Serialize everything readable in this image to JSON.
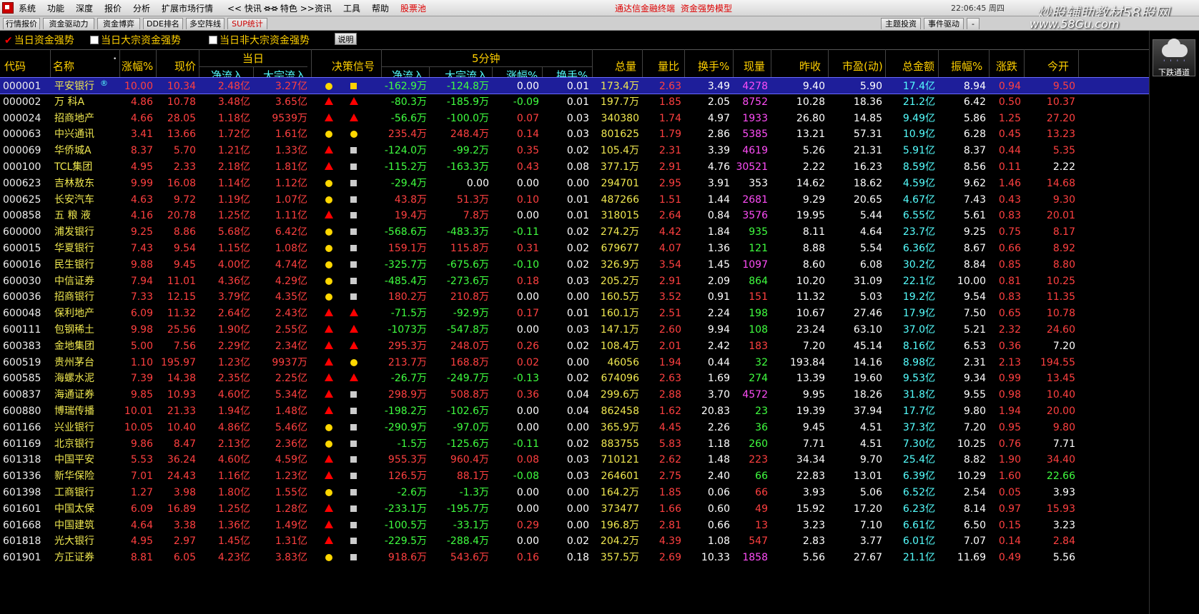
{
  "menubar": {
    "items": [
      "系统",
      "功能",
      "深度",
      "报价",
      "分析",
      "扩展市场行情",
      "<< 快讯 >>",
      "<< 特色 >>",
      "资讯",
      "工具",
      "帮助",
      "股票池"
    ],
    "right_links": [
      "通达信金融终端",
      "资金强势模型"
    ],
    "clock": "22:06:45 周四"
  },
  "brand": {
    "watermark": "炒股辅助教材58股网",
    "url": "www.58Gu.com"
  },
  "tabs": [
    "行情报价",
    "资金驱动力",
    "资金博弈",
    "DDE排名",
    "多空阵线",
    "SUP统计"
  ],
  "tabs_right": [
    "主题投资",
    "事件驱动",
    "-"
  ],
  "filters": {
    "opt1": "当日资金强势",
    "opt2": "当日大宗资金强势",
    "opt3": "当日非大宗资金强势",
    "explain": "说明"
  },
  "header": {
    "code": "代码",
    "name": "名称",
    "change_pct": "涨幅%",
    "price": "现价",
    "today": "当日",
    "net_inflow": "净流入",
    "block_inflow": "大宗流入",
    "signal": "决策信号",
    "five_min": "5分钟",
    "net_inflow_5": "净流入",
    "block_inflow_5": "大宗流入",
    "change_pct_5": "涨幅%",
    "turnover_5": "换手%",
    "total_vol": "总量",
    "vol_ratio": "量比",
    "turnover": "换手%",
    "cur_vol": "现量",
    "prev_close": "昨收",
    "pe": "市盈(动)",
    "amount": "总金额",
    "amplitude": "振幅%",
    "change": "涨跌",
    "open": "今开"
  },
  "side": {
    "weather_label": "下跌通道"
  },
  "rows": [
    {
      "code": "000001",
      "name": "平安银行",
      "mark": "®",
      "chg": "10.00",
      "price": "10.34",
      "net": "2.48亿",
      "blk": "3.27亿",
      "s1": "circle",
      "s2": "square-yellow",
      "net5": "-162.9万",
      "blk5": "-124.8万",
      "chg5": "0.00",
      "to5": "0.01",
      "vol": "173.4万",
      "vr": "2.63",
      "to": "3.49",
      "cv": "4278",
      "pc": "9.40",
      "pe": "5.90",
      "amt": "17.4亿",
      "amp": "8.94",
      "d": "0.94",
      "op": "9.50",
      "net5dir": "dn",
      "blk5dir": "dn",
      "chg5dir": "wh",
      "cvdir": "mg",
      "opdir": "up"
    },
    {
      "code": "000002",
      "name": "万  科A",
      "mark": "",
      "chg": "4.86",
      "price": "10.78",
      "net": "3.48亿",
      "blk": "3.65亿",
      "s1": "triangle",
      "s2": "triangle",
      "net5": "-80.3万",
      "blk5": "-185.9万",
      "chg5": "-0.09",
      "to5": "0.01",
      "vol": "197.7万",
      "vr": "1.85",
      "to": "2.05",
      "cv": "8752",
      "pc": "10.28",
      "pe": "18.36",
      "amt": "21.2亿",
      "amp": "6.42",
      "d": "0.50",
      "op": "10.37",
      "net5dir": "dn",
      "blk5dir": "dn",
      "chg5dir": "dn",
      "cvdir": "mg",
      "opdir": "up"
    },
    {
      "code": "000024",
      "name": "招商地产",
      "mark": "",
      "chg": "4.66",
      "price": "28.05",
      "net": "1.18亿",
      "blk": "9539万",
      "s1": "triangle",
      "s2": "triangle",
      "net5": "-56.6万",
      "blk5": "-100.0万",
      "chg5": "0.07",
      "to5": "0.03",
      "vol": "340380",
      "vr": "1.74",
      "to": "4.97",
      "cv": "1933",
      "pc": "26.80",
      "pe": "14.85",
      "amt": "9.49亿",
      "amp": "5.86",
      "d": "1.25",
      "op": "27.20",
      "net5dir": "dn",
      "blk5dir": "dn",
      "chg5dir": "up",
      "cvdir": "mg",
      "opdir": "up"
    },
    {
      "code": "000063",
      "name": "中兴通讯",
      "mark": "",
      "chg": "3.41",
      "price": "13.66",
      "net": "1.72亿",
      "blk": "1.61亿",
      "s1": "circle",
      "s2": "circle",
      "net5": "235.4万",
      "blk5": "248.4万",
      "chg5": "0.14",
      "to5": "0.03",
      "vol": "801625",
      "vr": "1.79",
      "to": "2.86",
      "cv": "5385",
      "pc": "13.21",
      "pe": "57.31",
      "amt": "10.9亿",
      "amp": "6.28",
      "d": "0.45",
      "op": "13.23",
      "net5dir": "up",
      "blk5dir": "up",
      "chg5dir": "up",
      "cvdir": "mg",
      "opdir": "up"
    },
    {
      "code": "000069",
      "name": "华侨城A",
      "mark": "",
      "chg": "8.37",
      "price": "5.70",
      "net": "1.21亿",
      "blk": "1.33亿",
      "s1": "triangle",
      "s2": "square",
      "net5": "-124.0万",
      "blk5": "-99.2万",
      "chg5": "0.35",
      "to5": "0.02",
      "vol": "105.4万",
      "vr": "2.31",
      "to": "3.39",
      "cv": "4619",
      "pc": "5.26",
      "pe": "21.31",
      "amt": "5.91亿",
      "amp": "8.37",
      "d": "0.44",
      "op": "5.35",
      "net5dir": "dn",
      "blk5dir": "dn",
      "chg5dir": "up",
      "cvdir": "mg",
      "opdir": "up"
    },
    {
      "code": "000100",
      "name": "TCL集团",
      "mark": "",
      "chg": "4.95",
      "price": "2.33",
      "net": "2.18亿",
      "blk": "1.81亿",
      "s1": "triangle",
      "s2": "square",
      "net5": "-115.2万",
      "blk5": "-163.3万",
      "chg5": "0.43",
      "to5": "0.08",
      "vol": "377.1万",
      "vr": "2.91",
      "to": "4.76",
      "cv": "30521",
      "pc": "2.22",
      "pe": "16.23",
      "amt": "8.59亿",
      "amp": "8.56",
      "d": "0.11",
      "op": "2.22",
      "net5dir": "dn",
      "blk5dir": "dn",
      "chg5dir": "up",
      "cvdir": "mg",
      "opdir": "wh"
    },
    {
      "code": "000623",
      "name": "吉林敖东",
      "mark": "",
      "chg": "9.99",
      "price": "16.08",
      "net": "1.14亿",
      "blk": "1.12亿",
      "s1": "circle",
      "s2": "square",
      "net5": "-29.4万",
      "blk5": "0.00",
      "chg5": "0.00",
      "to5": "0.00",
      "vol": "294701",
      "vr": "2.95",
      "to": "3.91",
      "cv": "353",
      "pc": "14.62",
      "pe": "18.62",
      "amt": "4.59亿",
      "amp": "9.62",
      "d": "1.46",
      "op": "14.68",
      "net5dir": "dn",
      "blk5dir": "wh",
      "chg5dir": "wh",
      "cvdir": "wh",
      "opdir": "up"
    },
    {
      "code": "000625",
      "name": "长安汽车",
      "mark": "",
      "chg": "4.63",
      "price": "9.72",
      "net": "1.19亿",
      "blk": "1.07亿",
      "s1": "circle",
      "s2": "square",
      "net5": "43.8万",
      "blk5": "51.3万",
      "chg5": "0.10",
      "to5": "0.01",
      "vol": "487266",
      "vr": "1.51",
      "to": "1.44",
      "cv": "2681",
      "pc": "9.29",
      "pe": "20.65",
      "amt": "4.67亿",
      "amp": "7.43",
      "d": "0.43",
      "op": "9.30",
      "net5dir": "up",
      "blk5dir": "up",
      "chg5dir": "up",
      "cvdir": "mg",
      "opdir": "up"
    },
    {
      "code": "000858",
      "name": "五 粮 液",
      "mark": "",
      "chg": "4.16",
      "price": "20.78",
      "net": "1.25亿",
      "blk": "1.11亿",
      "s1": "triangle",
      "s2": "square",
      "net5": "19.4万",
      "blk5": "7.8万",
      "chg5": "0.00",
      "to5": "0.01",
      "vol": "318015",
      "vr": "2.64",
      "to": "0.84",
      "cv": "3576",
      "pc": "19.95",
      "pe": "5.44",
      "amt": "6.55亿",
      "amp": "5.61",
      "d": "0.83",
      "op": "20.01",
      "net5dir": "up",
      "blk5dir": "up",
      "chg5dir": "wh",
      "cvdir": "mg",
      "opdir": "up"
    },
    {
      "code": "600000",
      "name": "浦发银行",
      "mark": "",
      "chg": "9.25",
      "price": "8.86",
      "net": "5.68亿",
      "blk": "6.42亿",
      "s1": "circle",
      "s2": "square",
      "net5": "-568.6万",
      "blk5": "-483.3万",
      "chg5": "-0.11",
      "to5": "0.02",
      "vol": "274.2万",
      "vr": "4.42",
      "to": "1.84",
      "cv": "935",
      "pc": "8.11",
      "pe": "4.64",
      "amt": "23.7亿",
      "amp": "9.25",
      "d": "0.75",
      "op": "8.17",
      "net5dir": "dn",
      "blk5dir": "dn",
      "chg5dir": "dn",
      "cvdir": "gr",
      "opdir": "up"
    },
    {
      "code": "600015",
      "name": "华夏银行",
      "mark": "",
      "chg": "7.43",
      "price": "9.54",
      "net": "1.15亿",
      "blk": "1.08亿",
      "s1": "circle",
      "s2": "square",
      "net5": "159.1万",
      "blk5": "115.8万",
      "chg5": "0.31",
      "to5": "0.02",
      "vol": "679677",
      "vr": "4.07",
      "to": "1.36",
      "cv": "121",
      "pc": "8.88",
      "pe": "5.54",
      "amt": "6.36亿",
      "amp": "8.67",
      "d": "0.66",
      "op": "8.92",
      "net5dir": "up",
      "blk5dir": "up",
      "chg5dir": "up",
      "cvdir": "gr",
      "opdir": "up"
    },
    {
      "code": "600016",
      "name": "民生银行",
      "mark": "",
      "chg": "9.88",
      "price": "9.45",
      "net": "4.00亿",
      "blk": "4.74亿",
      "s1": "circle",
      "s2": "square",
      "net5": "-325.7万",
      "blk5": "-675.6万",
      "chg5": "-0.10",
      "to5": "0.02",
      "vol": "326.9万",
      "vr": "3.54",
      "to": "1.45",
      "cv": "1097",
      "pc": "8.60",
      "pe": "6.08",
      "amt": "30.2亿",
      "amp": "8.84",
      "d": "0.85",
      "op": "8.80",
      "net5dir": "dn",
      "blk5dir": "dn",
      "chg5dir": "dn",
      "cvdir": "mg",
      "opdir": "up"
    },
    {
      "code": "600030",
      "name": "中信证券",
      "mark": "",
      "chg": "7.94",
      "price": "11.01",
      "net": "4.36亿",
      "blk": "4.29亿",
      "s1": "circle",
      "s2": "square",
      "net5": "-485.4万",
      "blk5": "-273.6万",
      "chg5": "0.18",
      "to5": "0.03",
      "vol": "205.2万",
      "vr": "2.91",
      "to": "2.09",
      "cv": "864",
      "pc": "10.20",
      "pe": "31.09",
      "amt": "22.1亿",
      "amp": "10.00",
      "d": "0.81",
      "op": "10.25",
      "net5dir": "dn",
      "blk5dir": "dn",
      "chg5dir": "up",
      "cvdir": "gr",
      "opdir": "up"
    },
    {
      "code": "600036",
      "name": "招商银行",
      "mark": "",
      "chg": "7.33",
      "price": "12.15",
      "net": "3.79亿",
      "blk": "4.35亿",
      "s1": "circle",
      "s2": "square",
      "net5": "180.2万",
      "blk5": "210.8万",
      "chg5": "0.00",
      "to5": "0.00",
      "vol": "160.5万",
      "vr": "3.52",
      "to": "0.91",
      "cv": "151",
      "pc": "11.32",
      "pe": "5.03",
      "amt": "19.2亿",
      "amp": "9.54",
      "d": "0.83",
      "op": "11.35",
      "net5dir": "up",
      "blk5dir": "up",
      "chg5dir": "wh",
      "cvdir": "up",
      "opdir": "up"
    },
    {
      "code": "600048",
      "name": "保利地产",
      "mark": "",
      "chg": "6.09",
      "price": "11.32",
      "net": "2.64亿",
      "blk": "2.43亿",
      "s1": "triangle",
      "s2": "triangle",
      "net5": "-71.5万",
      "blk5": "-92.9万",
      "chg5": "0.17",
      "to5": "0.01",
      "vol": "160.1万",
      "vr": "2.51",
      "to": "2.24",
      "cv": "198",
      "pc": "10.67",
      "pe": "27.46",
      "amt": "17.9亿",
      "amp": "7.50",
      "d": "0.65",
      "op": "10.78",
      "net5dir": "dn",
      "blk5dir": "dn",
      "chg5dir": "up",
      "cvdir": "gr",
      "opdir": "up"
    },
    {
      "code": "600111",
      "name": "包钢稀土",
      "mark": "",
      "chg": "9.98",
      "price": "25.56",
      "net": "1.90亿",
      "blk": "2.55亿",
      "s1": "triangle",
      "s2": "triangle",
      "net5": "-1073万",
      "blk5": "-547.8万",
      "chg5": "0.00",
      "to5": "0.03",
      "vol": "147.1万",
      "vr": "2.60",
      "to": "9.94",
      "cv": "108",
      "pc": "23.24",
      "pe": "63.10",
      "amt": "37.0亿",
      "amp": "5.21",
      "d": "2.32",
      "op": "24.60",
      "net5dir": "dn",
      "blk5dir": "dn",
      "chg5dir": "wh",
      "cvdir": "gr",
      "opdir": "up"
    },
    {
      "code": "600383",
      "name": "金地集团",
      "mark": "",
      "chg": "5.00",
      "price": "7.56",
      "net": "2.29亿",
      "blk": "2.34亿",
      "s1": "triangle",
      "s2": "triangle",
      "net5": "295.3万",
      "blk5": "248.0万",
      "chg5": "0.26",
      "to5": "0.02",
      "vol": "108.4万",
      "vr": "2.01",
      "to": "2.42",
      "cv": "183",
      "pc": "7.20",
      "pe": "45.14",
      "amt": "8.16亿",
      "amp": "6.53",
      "d": "0.36",
      "op": "7.20",
      "net5dir": "up",
      "blk5dir": "up",
      "chg5dir": "up",
      "cvdir": "up",
      "opdir": "wh"
    },
    {
      "code": "600519",
      "name": "贵州茅台",
      "mark": "",
      "chg": "1.10",
      "price": "195.97",
      "net": "1.23亿",
      "blk": "9937万",
      "s1": "triangle",
      "s2": "circle",
      "net5": "213.7万",
      "blk5": "168.8万",
      "chg5": "0.02",
      "to5": "0.00",
      "vol": "46056",
      "vr": "1.94",
      "to": "0.44",
      "cv": "32",
      "pc": "193.84",
      "pe": "14.16",
      "amt": "8.98亿",
      "amp": "2.31",
      "d": "2.13",
      "op": "194.55",
      "net5dir": "up",
      "blk5dir": "up",
      "chg5dir": "up",
      "cvdir": "gr",
      "opdir": "up"
    },
    {
      "code": "600585",
      "name": "海螺水泥",
      "mark": "",
      "chg": "7.39",
      "price": "14.38",
      "net": "2.35亿",
      "blk": "2.25亿",
      "s1": "triangle",
      "s2": "triangle",
      "net5": "-26.7万",
      "blk5": "-249.7万",
      "chg5": "-0.13",
      "to5": "0.02",
      "vol": "674096",
      "vr": "2.63",
      "to": "1.69",
      "cv": "274",
      "pc": "13.39",
      "pe": "19.60",
      "amt": "9.53亿",
      "amp": "9.34",
      "d": "0.99",
      "op": "13.45",
      "net5dir": "dn",
      "blk5dir": "dn",
      "chg5dir": "dn",
      "cvdir": "gr",
      "opdir": "up"
    },
    {
      "code": "600837",
      "name": "海通证券",
      "mark": "",
      "chg": "9.85",
      "price": "10.93",
      "net": "4.60亿",
      "blk": "5.34亿",
      "s1": "triangle",
      "s2": "square",
      "net5": "298.9万",
      "blk5": "508.8万",
      "chg5": "0.36",
      "to5": "0.04",
      "vol": "299.6万",
      "vr": "2.88",
      "to": "3.70",
      "cv": "4572",
      "pc": "9.95",
      "pe": "18.26",
      "amt": "31.8亿",
      "amp": "9.55",
      "d": "0.98",
      "op": "10.40",
      "net5dir": "up",
      "blk5dir": "up",
      "chg5dir": "up",
      "cvdir": "mg",
      "opdir": "up"
    },
    {
      "code": "600880",
      "name": "博瑞传播",
      "mark": "",
      "chg": "10.01",
      "price": "21.33",
      "net": "1.94亿",
      "blk": "1.48亿",
      "s1": "triangle",
      "s2": "square",
      "net5": "-198.2万",
      "blk5": "-102.6万",
      "chg5": "0.00",
      "to5": "0.04",
      "vol": "862458",
      "vr": "1.62",
      "to": "20.83",
      "cv": "23",
      "pc": "19.39",
      "pe": "37.94",
      "amt": "17.7亿",
      "amp": "9.80",
      "d": "1.94",
      "op": "20.00",
      "net5dir": "dn",
      "blk5dir": "dn",
      "chg5dir": "wh",
      "cvdir": "gr",
      "opdir": "up"
    },
    {
      "code": "601166",
      "name": "兴业银行",
      "mark": "",
      "chg": "10.05",
      "price": "10.40",
      "net": "4.86亿",
      "blk": "5.46亿",
      "s1": "circle",
      "s2": "square",
      "net5": "-290.9万",
      "blk5": "-97.0万",
      "chg5": "0.00",
      "to5": "0.00",
      "vol": "365.9万",
      "vr": "4.45",
      "to": "2.26",
      "cv": "36",
      "pc": "9.45",
      "pe": "4.51",
      "amt": "37.3亿",
      "amp": "7.20",
      "d": "0.95",
      "op": "9.80",
      "net5dir": "dn",
      "blk5dir": "dn",
      "chg5dir": "wh",
      "cvdir": "gr",
      "opdir": "up"
    },
    {
      "code": "601169",
      "name": "北京银行",
      "mark": "",
      "chg": "9.86",
      "price": "8.47",
      "net": "2.13亿",
      "blk": "2.36亿",
      "s1": "circle",
      "s2": "square",
      "net5": "-1.5万",
      "blk5": "-125.6万",
      "chg5": "-0.11",
      "to5": "0.02",
      "vol": "883755",
      "vr": "5.83",
      "to": "1.18",
      "cv": "260",
      "pc": "7.71",
      "pe": "4.51",
      "amt": "7.30亿",
      "amp": "10.25",
      "d": "0.76",
      "op": "7.71",
      "net5dir": "dn",
      "blk5dir": "dn",
      "chg5dir": "dn",
      "cvdir": "gr",
      "opdir": "wh"
    },
    {
      "code": "601318",
      "name": "中国平安",
      "mark": "",
      "chg": "5.53",
      "price": "36.24",
      "net": "4.60亿",
      "blk": "4.59亿",
      "s1": "triangle",
      "s2": "square",
      "net5": "955.3万",
      "blk5": "960.4万",
      "chg5": "0.08",
      "to5": "0.03",
      "vol": "710121",
      "vr": "2.62",
      "to": "1.48",
      "cv": "223",
      "pc": "34.34",
      "pe": "9.70",
      "amt": "25.4亿",
      "amp": "8.82",
      "d": "1.90",
      "op": "34.40",
      "net5dir": "up",
      "blk5dir": "up",
      "chg5dir": "up",
      "cvdir": "up",
      "opdir": "up"
    },
    {
      "code": "601336",
      "name": "新华保险",
      "mark": "",
      "chg": "7.01",
      "price": "24.43",
      "net": "1.16亿",
      "blk": "1.23亿",
      "s1": "triangle",
      "s2": "square",
      "net5": "126.5万",
      "blk5": "88.1万",
      "chg5": "-0.08",
      "to5": "0.03",
      "vol": "264601",
      "vr": "2.75",
      "to": "2.40",
      "cv": "66",
      "pc": "22.83",
      "pe": "13.01",
      "amt": "6.39亿",
      "amp": "10.29",
      "d": "1.60",
      "op": "22.66",
      "net5dir": "up",
      "blk5dir": "up",
      "chg5dir": "dn",
      "cvdir": "gr",
      "opdir": "dn"
    },
    {
      "code": "601398",
      "name": "工商银行",
      "mark": "",
      "chg": "1.27",
      "price": "3.98",
      "net": "1.80亿",
      "blk": "1.55亿",
      "s1": "circle",
      "s2": "square",
      "net5": "-2.6万",
      "blk5": "-1.3万",
      "chg5": "0.00",
      "to5": "0.00",
      "vol": "164.2万",
      "vr": "1.85",
      "to": "0.06",
      "cv": "66",
      "pc": "3.93",
      "pe": "5.06",
      "amt": "6.52亿",
      "amp": "2.54",
      "d": "0.05",
      "op": "3.93",
      "net5dir": "dn",
      "blk5dir": "dn",
      "chg5dir": "wh",
      "cvdir": "up",
      "opdir": "wh"
    },
    {
      "code": "601601",
      "name": "中国太保",
      "mark": "",
      "chg": "6.09",
      "price": "16.89",
      "net": "1.25亿",
      "blk": "1.28亿",
      "s1": "triangle",
      "s2": "square",
      "net5": "-233.1万",
      "blk5": "-195.7万",
      "chg5": "0.00",
      "to5": "0.00",
      "vol": "373477",
      "vr": "1.66",
      "to": "0.60",
      "cv": "49",
      "pc": "15.92",
      "pe": "17.20",
      "amt": "6.23亿",
      "amp": "8.14",
      "d": "0.97",
      "op": "15.93",
      "net5dir": "dn",
      "blk5dir": "dn",
      "chg5dir": "wh",
      "cvdir": "up",
      "opdir": "up"
    },
    {
      "code": "601668",
      "name": "中国建筑",
      "mark": "",
      "chg": "4.64",
      "price": "3.38",
      "net": "1.36亿",
      "blk": "1.49亿",
      "s1": "triangle",
      "s2": "square",
      "net5": "-100.5万",
      "blk5": "-33.1万",
      "chg5": "0.29",
      "to5": "0.00",
      "vol": "196.8万",
      "vr": "2.81",
      "to": "0.66",
      "cv": "13",
      "pc": "3.23",
      "pe": "7.10",
      "amt": "6.61亿",
      "amp": "6.50",
      "d": "0.15",
      "op": "3.23",
      "net5dir": "dn",
      "blk5dir": "dn",
      "chg5dir": "up",
      "cvdir": "up",
      "opdir": "wh"
    },
    {
      "code": "601818",
      "name": "光大银行",
      "mark": "",
      "chg": "4.95",
      "price": "2.97",
      "net": "1.45亿",
      "blk": "1.31亿",
      "s1": "triangle",
      "s2": "square",
      "net5": "-229.5万",
      "blk5": "-288.4万",
      "chg5": "0.00",
      "to5": "0.02",
      "vol": "204.2万",
      "vr": "4.39",
      "to": "1.08",
      "cv": "547",
      "pc": "2.83",
      "pe": "3.77",
      "amt": "6.01亿",
      "amp": "7.07",
      "d": "0.14",
      "op": "2.84",
      "net5dir": "dn",
      "blk5dir": "dn",
      "chg5dir": "wh",
      "cvdir": "up",
      "opdir": "up"
    },
    {
      "code": "601901",
      "name": "方正证券",
      "mark": "",
      "chg": "8.81",
      "price": "6.05",
      "net": "4.23亿",
      "blk": "3.83亿",
      "s1": "circle",
      "s2": "square",
      "net5": "918.6万",
      "blk5": "543.6万",
      "chg5": "0.16",
      "to5": "0.18",
      "vol": "357.5万",
      "vr": "2.69",
      "to": "10.33",
      "cv": "1858",
      "pc": "5.56",
      "pe": "27.67",
      "amt": "21.1亿",
      "amp": "11.69",
      "d": "0.49",
      "op": "5.56",
      "net5dir": "up",
      "blk5dir": "up",
      "chg5dir": "up",
      "cvdir": "mg",
      "opdir": "wh"
    }
  ]
}
